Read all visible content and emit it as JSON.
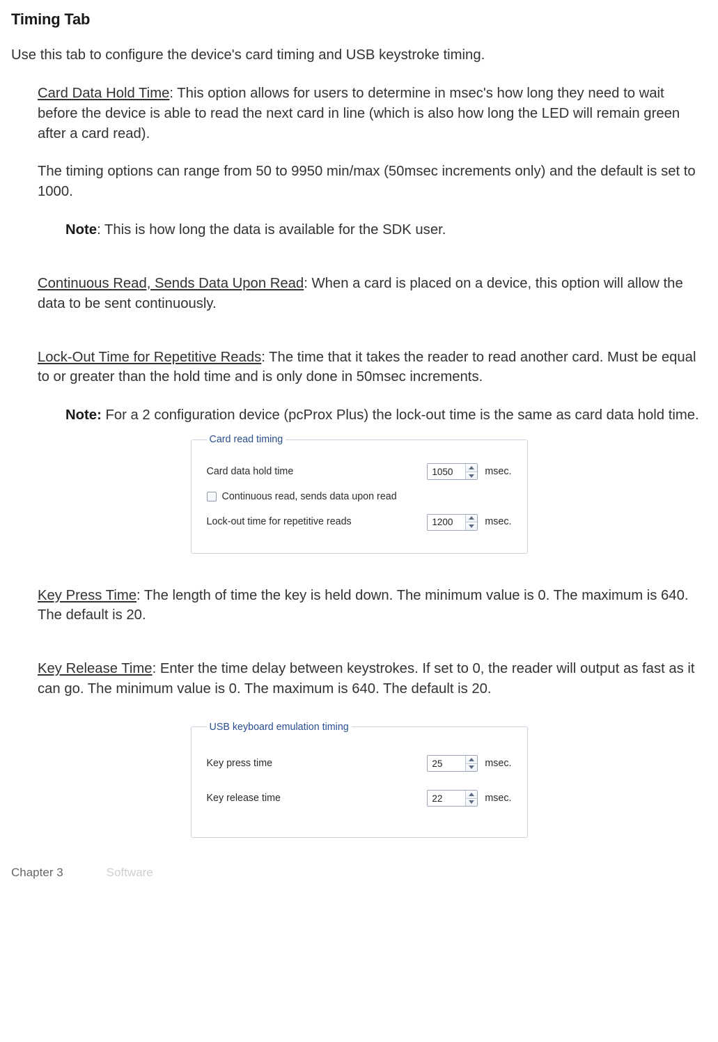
{
  "title": "Timing Tab",
  "intro": "Use this tab to configure the device's card timing and USB keystroke timing.",
  "cardHold": {
    "label": "Card Data Hold Time",
    "desc": ": This option allows for users to determine in msec's how long they need to wait before the device is able to read the next card in line (which is also how long the LED will remain green after a card read).",
    "range": "The timing options can range from 50 to 9950 min/max (50msec increments only) and the default is set to 1000."
  },
  "note1": {
    "label": "Note",
    "text": ": This is how long the data is available for the SDK user."
  },
  "continuous": {
    "label": "Continuous Read, Sends Data Upon Read",
    "desc": ": When a card is placed on a device, this option will allow the data to be sent continuously."
  },
  "lockout": {
    "label": "Lock-Out Time for Repetitive Reads",
    "desc": ": The time that it takes the reader to read another card. Must be equal to or greater than the hold time and is only done in 50msec increments."
  },
  "note2": {
    "label": "Note:",
    "text": " For a 2 configuration device (pcProx Plus) the lock-out time is the same as card data hold time."
  },
  "panel1": {
    "legend": "Card read timing",
    "holdLabel": "Card data hold time",
    "holdValue": "1050",
    "checkboxLabel": "Continuous read, sends data upon read",
    "lockoutLabel": "Lock-out time for repetitive reads",
    "lockoutValue": "1200",
    "unit": "msec."
  },
  "keyPress": {
    "label": "Key Press Time",
    "desc": ": The length of time the key is held down. The minimum value is 0. The maximum is 640. The default is 20."
  },
  "keyRelease": {
    "label": "Key Release Time",
    "desc": ": Enter the time delay between keystrokes. If set to 0, the reader will output as fast as it can go. The minimum value is 0. The maximum is 640. The default is 20."
  },
  "panel2": {
    "legend": "USB keyboard emulation timing",
    "pressLabel": "Key press time",
    "pressValue": "25",
    "releaseLabel": "Key release time",
    "releaseValue": "22",
    "unit": "msec."
  },
  "footer": {
    "chapter": "Chapter 3",
    "section": "Software"
  }
}
